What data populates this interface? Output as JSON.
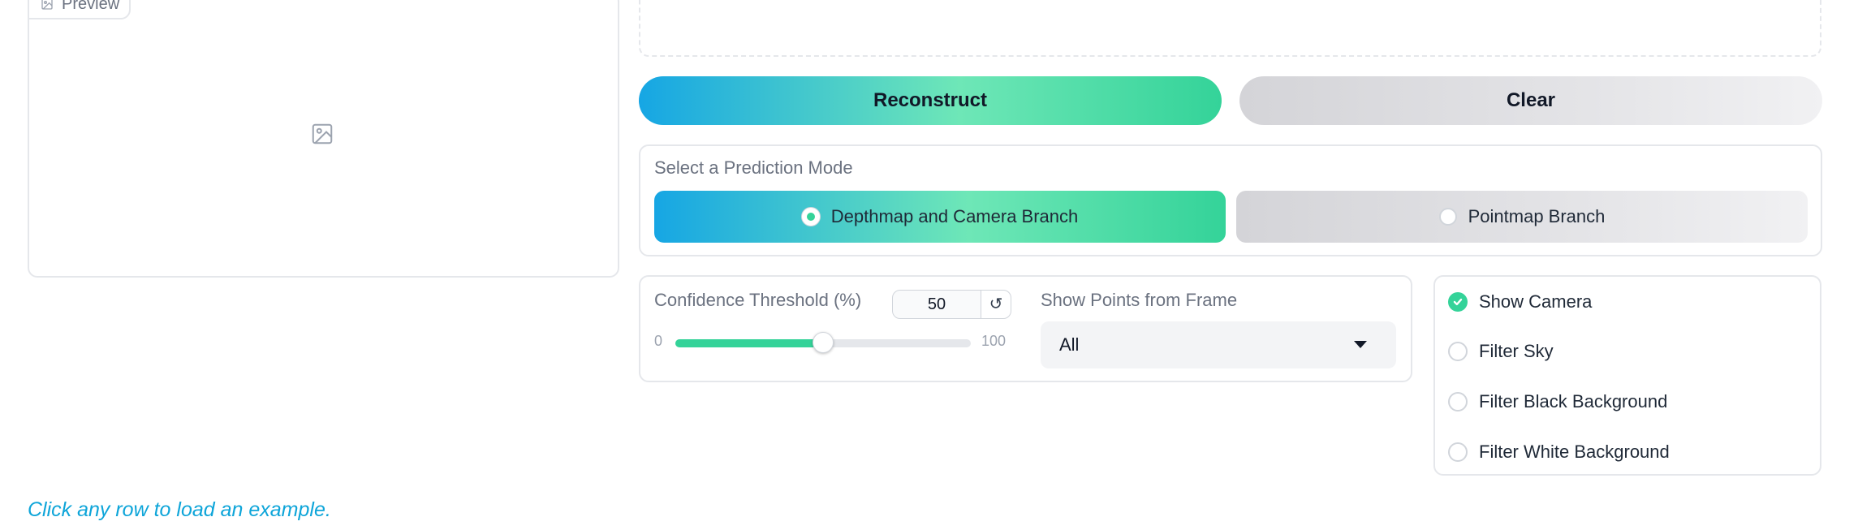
{
  "preview": {
    "label": "Preview",
    "icon": "image-icon"
  },
  "actions": {
    "reconstruct_label": "Reconstruct",
    "clear_label": "Clear"
  },
  "prediction_mode": {
    "label": "Select a Prediction Mode",
    "options": [
      "Depthmap and Camera Branch",
      "Pointmap Branch"
    ],
    "selected": "Depthmap and Camera Branch"
  },
  "confidence": {
    "label": "Confidence Threshold (%)",
    "value": "50",
    "min": "0",
    "max": "100",
    "reset_glyph": "↺"
  },
  "frame_filter": {
    "label": "Show Points from Frame",
    "value": "All"
  },
  "toggles": [
    {
      "label": "Show Camera",
      "checked": true
    },
    {
      "label": "Filter Sky",
      "checked": false
    },
    {
      "label": "Filter Black Background",
      "checked": false
    },
    {
      "label": "Filter White Background",
      "checked": false
    }
  ],
  "examples_hint": "Click any row to load an example.",
  "colors": {
    "accent_green": "#34d399",
    "accent_blue": "#16a6e4",
    "link_blue": "#0ea5d9"
  }
}
